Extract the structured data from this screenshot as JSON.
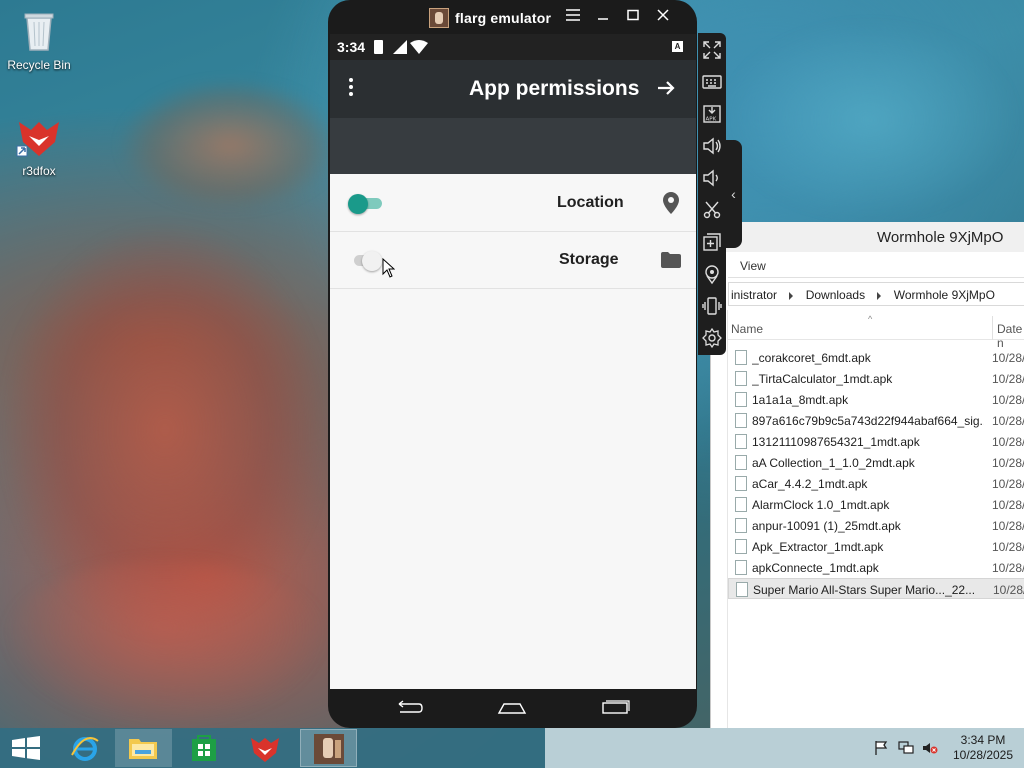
{
  "desktop": {
    "icons": [
      {
        "label": "Recycle Bin"
      },
      {
        "label": "r3dfox"
      }
    ]
  },
  "emulator": {
    "title": "flarg emulator",
    "status_time": "3:34",
    "app_title": "App permissions",
    "permissions": [
      {
        "label": "Location",
        "enabled": true,
        "icon": "location-pin-icon"
      },
      {
        "label": "Storage",
        "enabled": false,
        "icon": "folder-icon"
      }
    ]
  },
  "explorer": {
    "title": "Wormhole 9XjMpO",
    "ribbon_tab": "View",
    "breadcrumb": [
      "inistrator",
      "Downloads",
      "Wormhole 9XjMpO"
    ],
    "columns": {
      "name": "Name",
      "date": "Date n"
    },
    "files": [
      {
        "name": "_corakcoret_6mdt.apk",
        "date": "10/28/"
      },
      {
        "name": "_TirtaCalculator_1mdt.apk",
        "date": "10/28/"
      },
      {
        "name": "1a1a1a_8mdt.apk",
        "date": "10/28/"
      },
      {
        "name": "897a616c79b9c5a743d22f944abaf664_sig...",
        "date": "10/28/"
      },
      {
        "name": "13121110987654321_1mdt.apk",
        "date": "10/28/"
      },
      {
        "name": "aA Collection_1_1.0_2mdt.apk",
        "date": "10/28/"
      },
      {
        "name": "aCar_4.4.2_1mdt.apk",
        "date": "10/28/"
      },
      {
        "name": "AlarmClock 1.0_1mdt.apk",
        "date": "10/28/"
      },
      {
        "name": "anpur-10091 (1)_25mdt.apk",
        "date": "10/28/"
      },
      {
        "name": "Apk_Extractor_1mdt.apk",
        "date": "10/28/"
      },
      {
        "name": "apkConnecte_1mdt.apk",
        "date": "10/28/"
      },
      {
        "name": "Super Mario All-Stars   Super Mario..._22...",
        "date": "10/28/"
      }
    ]
  },
  "taskbar": {
    "time": "3:34 PM",
    "date": "10/28/2025"
  },
  "colors": {
    "accent": "#1a9a8a",
    "appbar": "#2b2f32",
    "emulator_frame": "#1b1b1b"
  }
}
